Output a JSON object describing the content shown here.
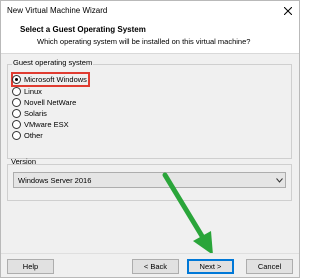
{
  "window": {
    "title": "New Virtual Machine Wizard"
  },
  "header": {
    "title": "Select a Guest Operating System",
    "subtitle": "Which operating system will be installed on this virtual machine?"
  },
  "guest_os": {
    "group_label": "Guest operating system",
    "options": [
      {
        "label": "Microsoft Windows",
        "selected": true
      },
      {
        "label": "Linux",
        "selected": false
      },
      {
        "label": "Novell NetWare",
        "selected": false
      },
      {
        "label": "Solaris",
        "selected": false
      },
      {
        "label": "VMware ESX",
        "selected": false
      },
      {
        "label": "Other",
        "selected": false
      }
    ]
  },
  "version": {
    "label": "Version",
    "selected": "Windows Server 2016"
  },
  "footer": {
    "help_label": "Help",
    "back_label": "< Back",
    "next_label": "Next >",
    "cancel_label": "Cancel"
  },
  "colors": {
    "highlight": "#e03c31",
    "arrow": "#2aa53a",
    "primary_border": "#0078d7"
  }
}
